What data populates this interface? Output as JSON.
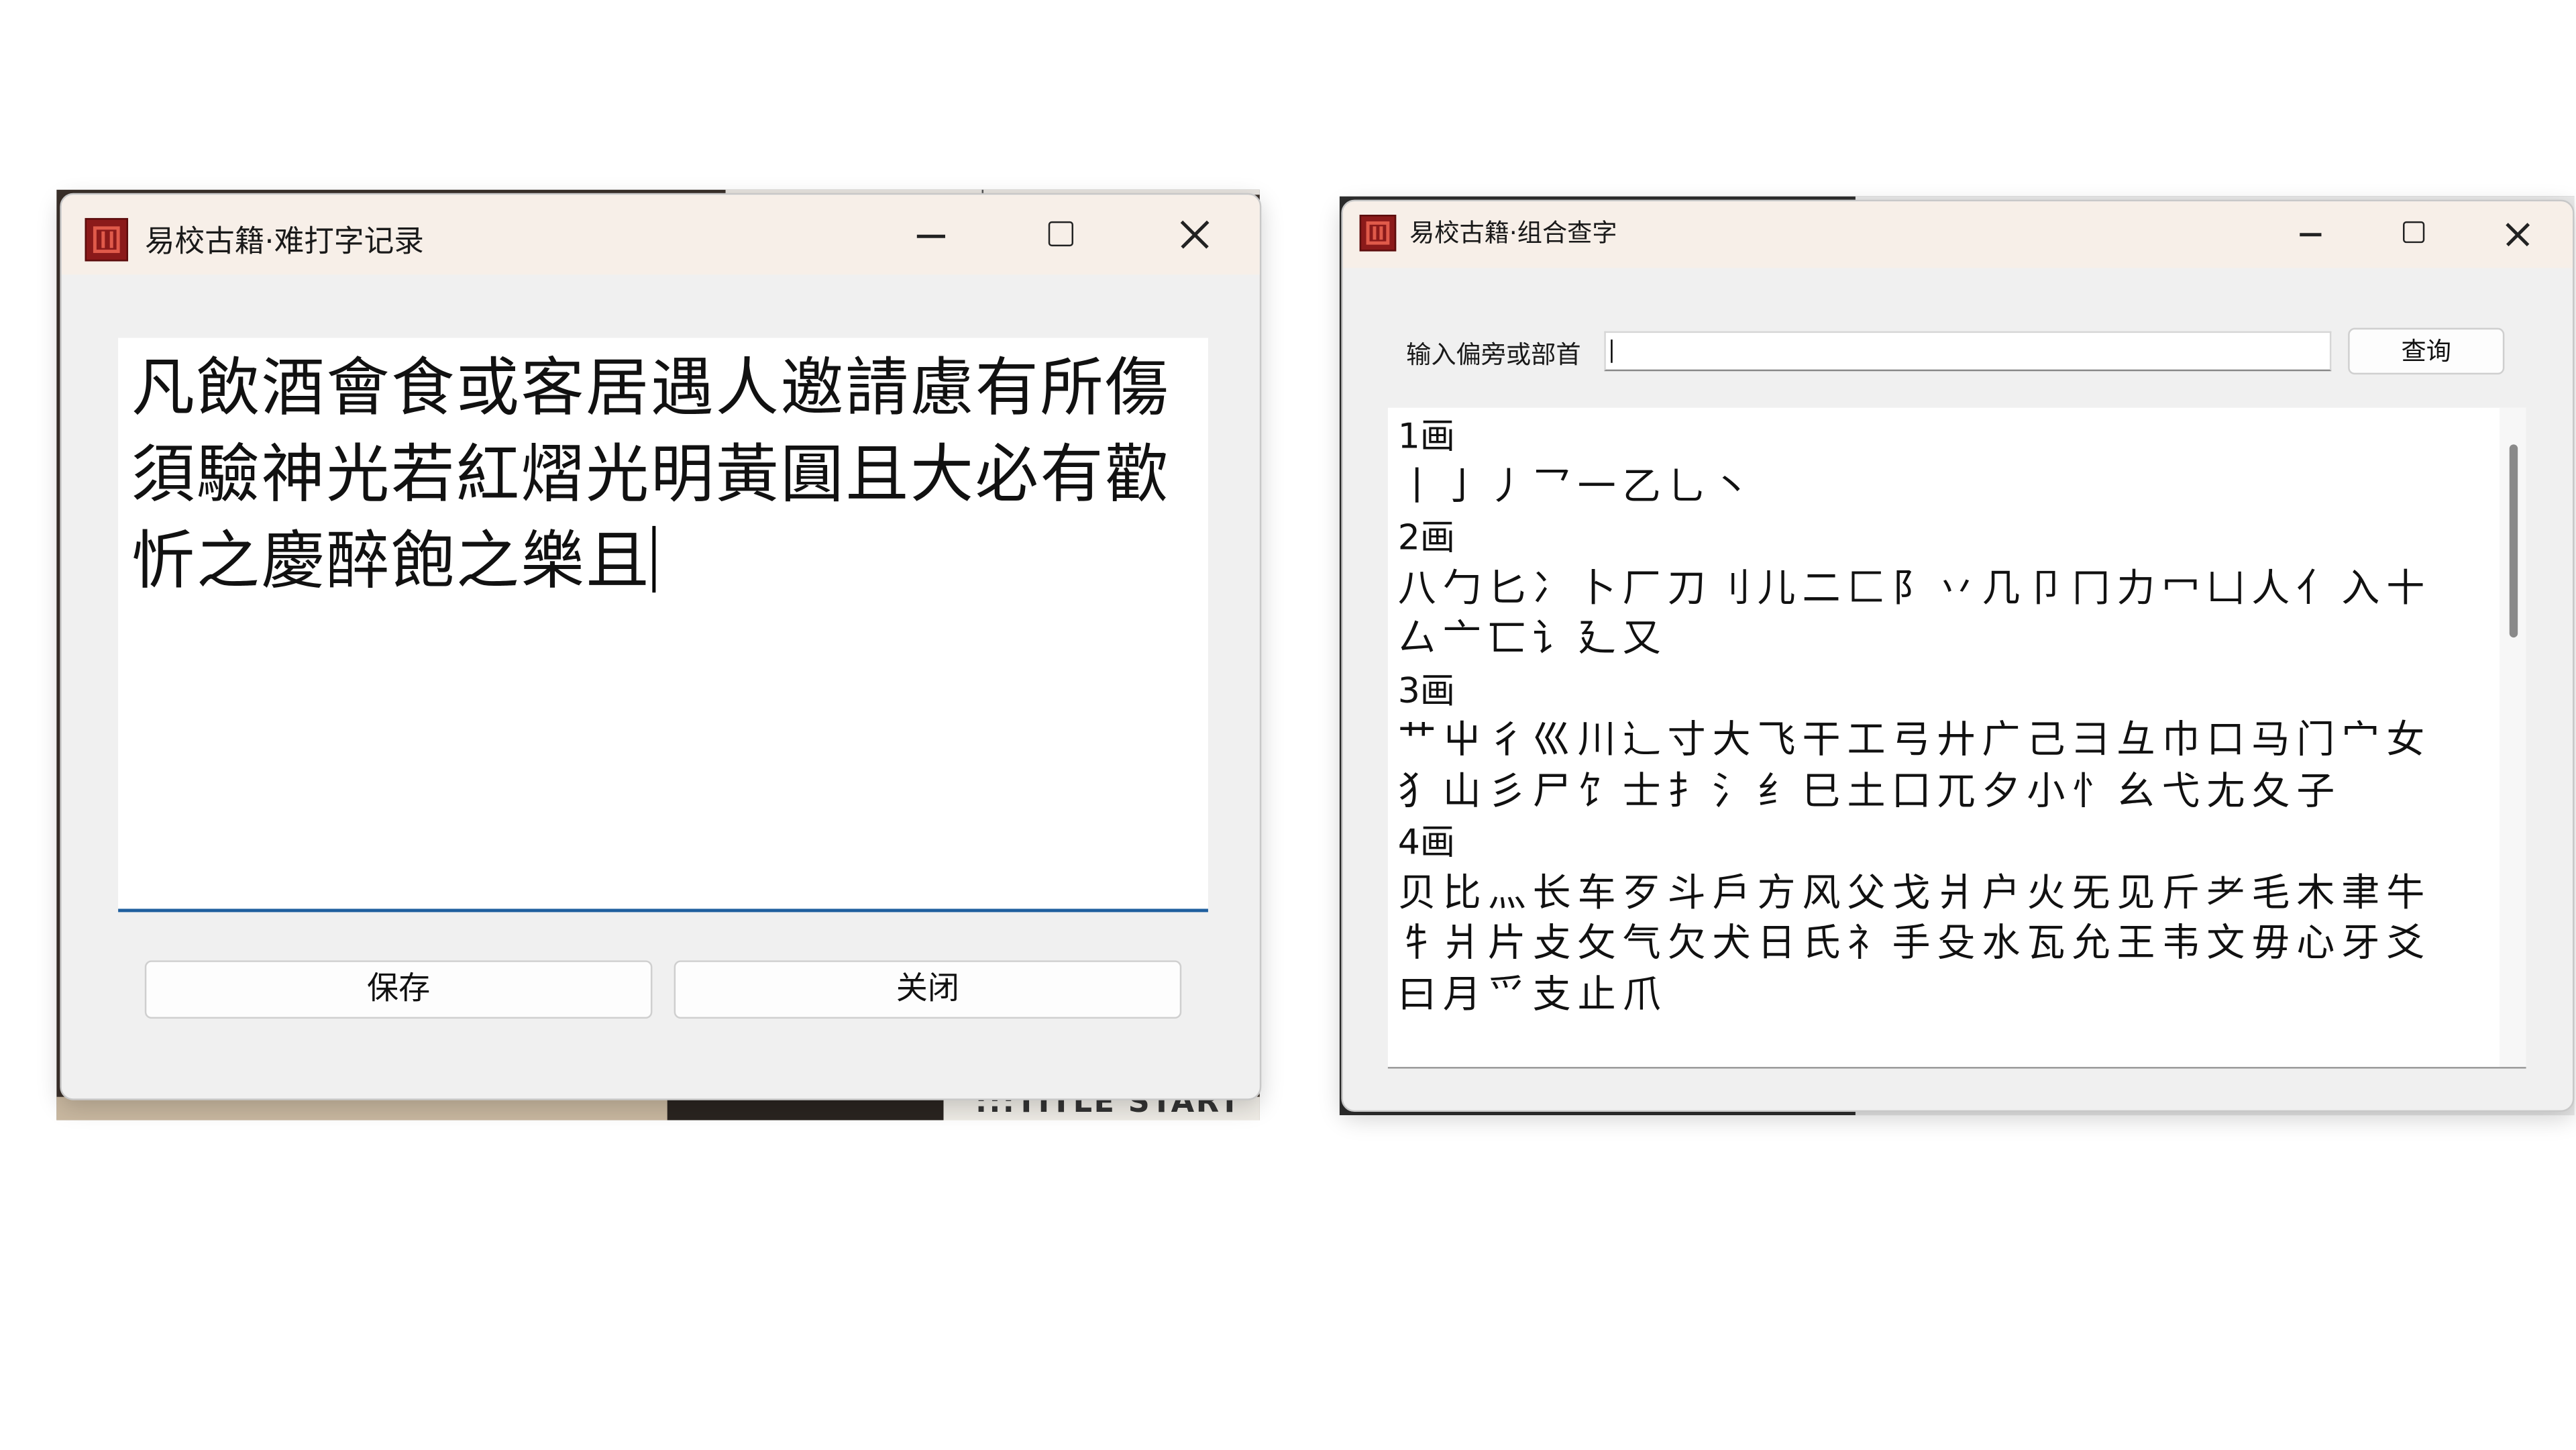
{
  "record_window": {
    "title": "易校古籍·难打字记录",
    "editor_text": "凡飲酒會食或客居遇人邀請慮有所傷須驗神光若紅熠光明黃圓且大必有歡忻之慶醉飽之樂且",
    "buttons": {
      "save": "保存",
      "close": "关闭"
    }
  },
  "lookup_window": {
    "title": "易校古籍·组合查字",
    "search": {
      "label": "输入偏旁或部首",
      "value": "",
      "query_button": "查询"
    },
    "results": [
      {
        "strokes": "1画",
        "radicals": "丨亅丿乛一乙乚丶"
      },
      {
        "strokes": "2画",
        "radicals": "八勹匕冫卜厂刀刂儿二匚阝丷几卩冂力冖凵人亻入十厶亠匸讠廴又"
      },
      {
        "strokes": "3画",
        "radicals": "艹屮彳巛川辶寸大飞干工弓廾广己彐彑巾口马门宀女犭山彡尸饣士扌氵纟巳土囗兀夕小忄幺弋尢夂子"
      },
      {
        "strokes": "4画",
        "radicals": "贝比灬长车歹斗戶方风父戈爿户火旡见斤耂毛木聿牛牜爿片攴攵气欠犬日氏礻手殳水瓦允王韦文毋心牙爻曰月爫支止爪"
      }
    ]
  },
  "background": {
    "ghost_text": ":::TITLE START"
  }
}
